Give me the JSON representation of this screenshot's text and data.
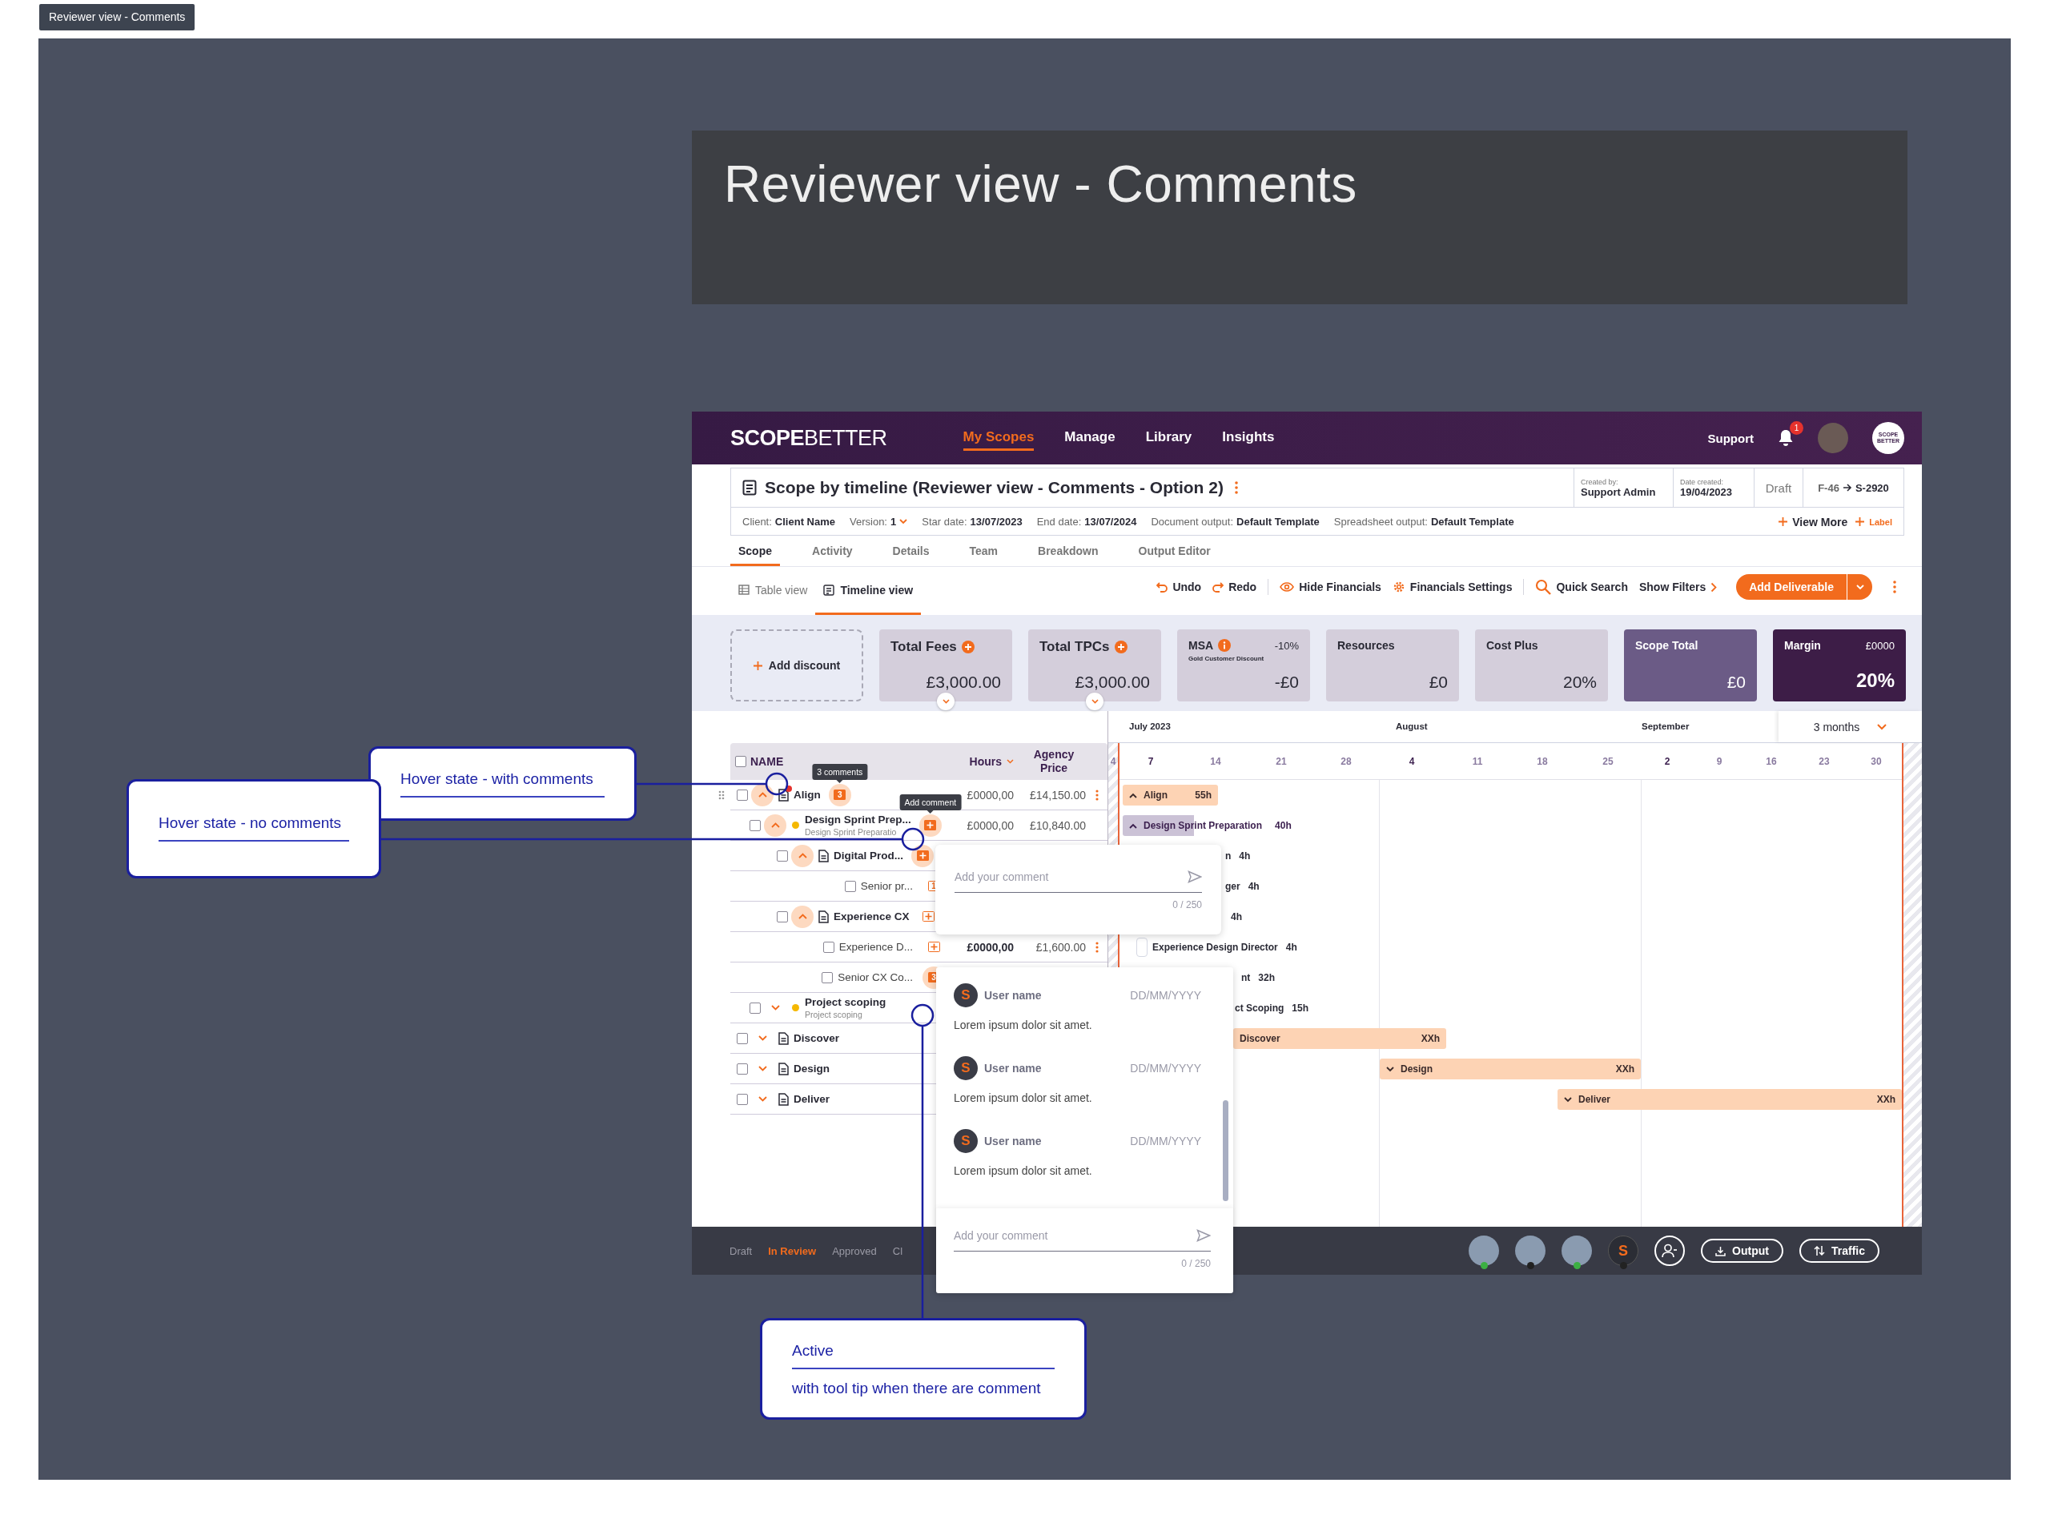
{
  "frame_label": "Reviewer view - Comments",
  "title_panel": {
    "title": "Reviewer view - Comments"
  },
  "app": {
    "nav": {
      "logo": "**SCOPE**BETTER",
      "items": [
        {
          "label": "My Scopes",
          "selected": true
        },
        {
          "label": "Manage",
          "selected": false
        },
        {
          "label": "Library",
          "selected": false
        },
        {
          "label": "Insights",
          "selected": false
        }
      ],
      "support": "Support",
      "notification_count": "1",
      "brand_badge": "SCOPE BETTER"
    },
    "header": {
      "title": "Scope by timeline (Reviewer view - Comments - Option 2)",
      "created_by": {
        "label": "Created by:",
        "value": "Support Admin"
      },
      "date_created": {
        "label": "Date created:",
        "value": "19/04/2023"
      },
      "status": "Draft",
      "ref_from": "F-46",
      "ref_to": "S-2920",
      "meta": [
        {
          "label": "Client:",
          "value": "Client Name"
        },
        {
          "label": "Version:",
          "value": "1",
          "dropdown": true
        },
        {
          "label": "Star date:",
          "value": "13/07/2023"
        },
        {
          "label": "End date:",
          "value": "13/07/2024"
        },
        {
          "label": "Document output:",
          "value": "Default Template"
        },
        {
          "label": "Spreadsheet output:",
          "value": "Default Template"
        }
      ],
      "view_more": "View More",
      "add_label": "Label"
    },
    "tabs": [
      {
        "label": "Scope",
        "selected": true
      },
      {
        "label": "Activity",
        "selected": false
      },
      {
        "label": "Details",
        "selected": false
      },
      {
        "label": "Team",
        "selected": false
      },
      {
        "label": "Breakdown",
        "selected": false
      },
      {
        "label": "Output Editor",
        "selected": false
      }
    ],
    "views": [
      {
        "label": "Table view",
        "kind": "table",
        "selected": false
      },
      {
        "label": "Timeline view",
        "kind": "timeline",
        "selected": true
      }
    ],
    "toolbar": {
      "undo": "Undo",
      "redo": "Redo",
      "hide_financials": "Hide Financials",
      "financials_settings": "Financials Settings",
      "quick_search": "Quick Search",
      "show_filters": "Show Filters",
      "add_deliverable": "Add Deliverable"
    },
    "summary": {
      "add_discount": "Add discount",
      "cards": [
        {
          "kind": "addable",
          "title": "Total Fees",
          "value": "£3,000.00",
          "expandable": true
        },
        {
          "kind": "addable",
          "title": "Total TPCs",
          "value": "£3,000.00",
          "expandable": true
        },
        {
          "kind": "msa",
          "title": "MSA",
          "rate": "-10%",
          "note": "Gold Customer Discount",
          "value": "-£0"
        },
        {
          "kind": "plain",
          "title": "Resources",
          "value": "£0"
        },
        {
          "kind": "plain",
          "title": "Cost Plus",
          "value": "20%"
        },
        {
          "kind": "total",
          "title": "Scope Total",
          "value": "£0"
        },
        {
          "kind": "margin",
          "title": "Margin",
          "amount": "£0000",
          "value": "20%"
        }
      ]
    },
    "table": {
      "columns": [
        "NAME",
        "Hours",
        "Agency Price"
      ],
      "all_checked": false,
      "rows": [
        {
          "name": "Align",
          "kind": "phase",
          "expanded": true,
          "checked": false,
          "hovered": true,
          "alert": true,
          "comment": {
            "count": "3",
            "filled": true,
            "highlighted": true,
            "tooltip": "3 comments"
          },
          "hours": "£0000,00",
          "price": "£14,150.00",
          "menu": true,
          "bar": {
            "kind": "phase",
            "label": "Align",
            "hours": "55h",
            "expanded": true
          },
          "children": [
            {
              "name": "Design Sprint Prep...",
              "subtitle": "Design Sprint Preparatio",
              "kind": "group",
              "color": "#f5b800",
              "expanded": true,
              "checked": false,
              "comment": {
                "filled": true,
                "highlighted": true,
                "tooltip": "Add comment"
              },
              "hours": "£0000,00",
              "price": "£10,840.00",
              "bar": {
                "kind": "group",
                "label": "Design Sprint Preparation",
                "hours": "40h",
                "expanded": true
              },
              "children": [
                {
                  "name": "Digital Prod...",
                  "kind": "deliverable",
                  "expanded": true,
                  "checked": false,
                  "comment": {
                    "filled": true,
                    "highlighted": true
                  },
                  "bar": {
                    "kind": "text",
                    "label": "n",
                    "hours": "4h"
                  },
                  "children": [
                    {
                      "name": "Senior pr...",
                      "kind": "role",
                      "checked": false,
                      "comment": {
                        "count": "1",
                        "filled": false,
                        "highlighted": false
                      },
                      "bar": {
                        "kind": "text",
                        "label": "ger",
                        "hours": "4h"
                      }
                    }
                  ]
                },
                {
                  "name": "Experience CX",
                  "kind": "deliverable",
                  "expanded": true,
                  "checked": false,
                  "comment": {
                    "filled": false,
                    "highlighted": false
                  },
                  "bar": {
                    "kind": "text",
                    "hours": "4h"
                  },
                  "children": [
                    {
                      "name": "Experience D...",
                      "kind": "role",
                      "checked": false,
                      "comment": {
                        "filled": false,
                        "highlighted": false
                      },
                      "hours": "£0000,00",
                      "price": "£1,600.00",
                      "menu": true,
                      "bar": {
                        "kind": "text",
                        "label": "Experience Design Director",
                        "hours": "4h",
                        "marker": true
                      }
                    },
                    {
                      "name": "Senior CX Co...",
                      "kind": "role",
                      "checked": false,
                      "comment": {
                        "count": "3",
                        "filled": true,
                        "highlighted": true
                      },
                      "bar": {
                        "kind": "text",
                        "label": "nt",
                        "hours": "32h"
                      }
                    }
                  ]
                }
              ]
            },
            {
              "name": "Project scoping",
              "subtitle": "Project scoping",
              "kind": "group",
              "color": "#f5b800",
              "expanded": false,
              "checked": false,
              "bar": {
                "kind": "text",
                "label": "ct Scoping",
                "hours": "15h"
              }
            }
          ]
        },
        {
          "name": "Discover",
          "kind": "phase",
          "expanded": false,
          "checked": false,
          "bar": {
            "kind": "phase",
            "label": "Discover",
            "hours": "XXh"
          }
        },
        {
          "name": "Design",
          "kind": "phase",
          "expanded": false,
          "checked": false,
          "bar": {
            "kind": "phase",
            "label": "Design",
            "hours": "XXh",
            "expanded": false
          }
        },
        {
          "name": "Deliver",
          "kind": "phase",
          "expanded": false,
          "checked": false,
          "bar": {
            "kind": "phase",
            "label": "Deliver",
            "hours": "XXh",
            "expanded": false
          }
        }
      ]
    },
    "timeline": {
      "months": [
        {
          "label": "July 2023"
        },
        {
          "label": "August"
        },
        {
          "label": "September"
        }
      ],
      "weeks": [
        {
          "label": "4",
          "month_start": false
        },
        {
          "label": "7",
          "month_start": true
        },
        {
          "label": "14",
          "month_start": false
        },
        {
          "label": "21",
          "month_start": false
        },
        {
          "label": "28",
          "month_start": false
        },
        {
          "label": "4",
          "month_start": true
        },
        {
          "label": "11",
          "month_start": false
        },
        {
          "label": "18",
          "month_start": false
        },
        {
          "label": "25",
          "month_start": false
        },
        {
          "label": "2",
          "month_start": true
        },
        {
          "label": "9",
          "month_start": false
        },
        {
          "label": "16",
          "month_start": false
        },
        {
          "label": "23",
          "month_start": false
        },
        {
          "label": "30",
          "month_start": false
        }
      ],
      "range": "3 months"
    },
    "comment_box": {
      "placeholder": "Add your comment",
      "counter": "0 / 250"
    },
    "comment_thread": {
      "comments": [
        {
          "initial": "S",
          "user": "User name",
          "date": "DD/MM/YYYY",
          "text": "Lorem ipsum dolor sit amet."
        },
        {
          "initial": "S",
          "user": "User name",
          "date": "DD/MM/YYYY",
          "text": "Lorem ipsum dolor sit amet."
        },
        {
          "initial": "S",
          "user": "User name",
          "date": "DD/MM/YYYY",
          "text": "Lorem ipsum dolor sit amet."
        }
      ],
      "placeholder": "Add your comment",
      "counter": "0 / 250"
    },
    "footer": {
      "stages": [
        {
          "label": "Draft",
          "selected": false
        },
        {
          "label": "In Review",
          "selected": true
        },
        {
          "label": "Approved",
          "selected": false
        },
        {
          "label": "Cl",
          "selected": false
        }
      ],
      "avatars": [
        {
          "kind": "photo",
          "color": "#3cb043"
        },
        {
          "kind": "photo",
          "color": "#222222"
        },
        {
          "kind": "photo",
          "color": "#3cb043"
        },
        {
          "kind": "initial",
          "initial": "S",
          "color": "#222222"
        }
      ],
      "output": "Output",
      "traffic": "Traffic"
    }
  },
  "annotations": [
    {
      "kind": "with_comments",
      "title": "Hover state - with comments"
    },
    {
      "kind": "no_comments",
      "title": "Hover state - no comments"
    },
    {
      "kind": "active",
      "title": "Active",
      "note": "with tool tip when there are comment"
    }
  ]
}
